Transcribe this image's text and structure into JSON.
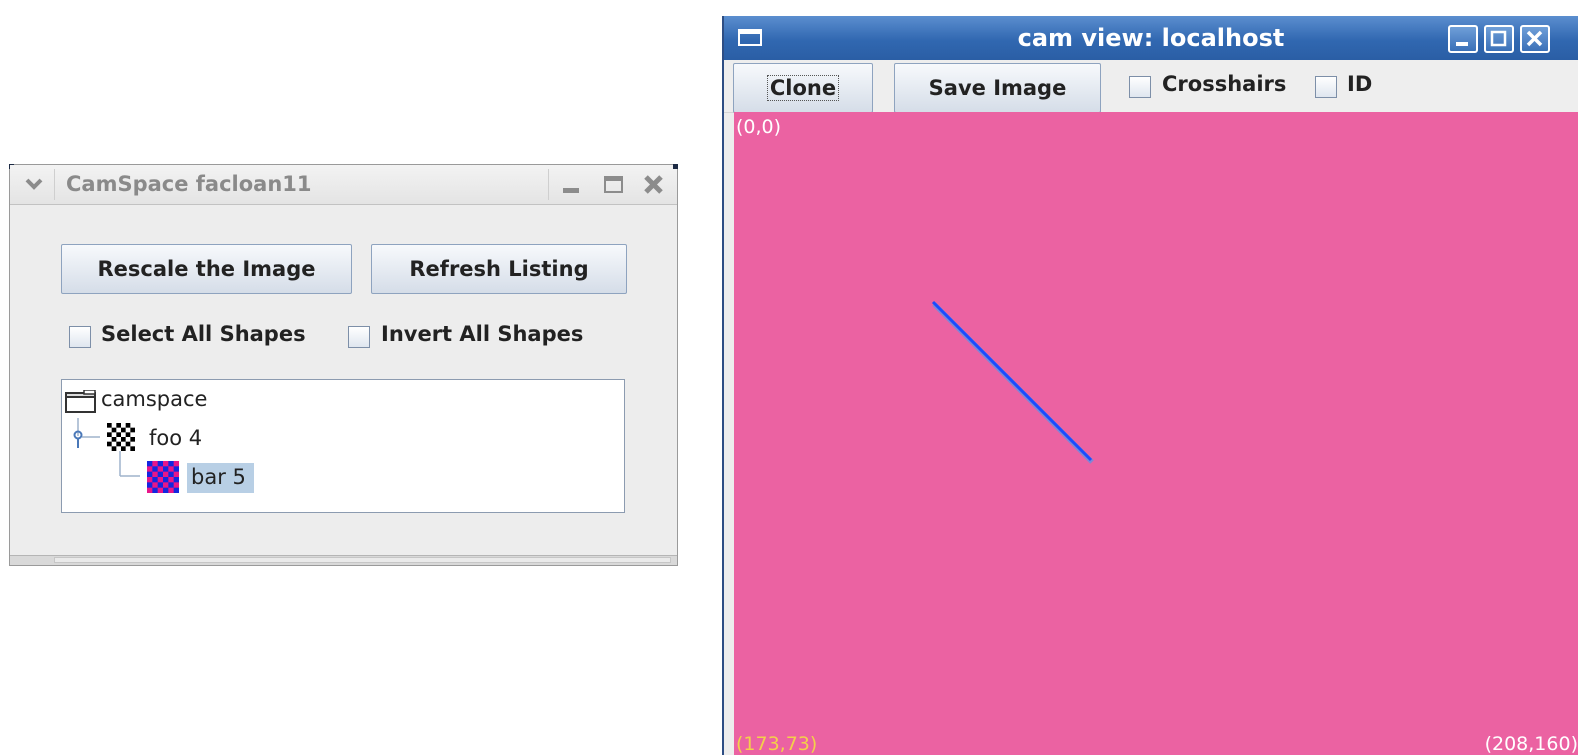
{
  "camspace_window": {
    "title": "CamSpace facloan11",
    "rescale_button": "Rescale the Image",
    "refresh_button": "Refresh Listing",
    "select_all_label": "Select All Shapes",
    "invert_all_label": "Invert All Shapes",
    "tree": {
      "root_label": "camspace",
      "foo_label": "foo 4",
      "bar_label": "bar 5"
    }
  },
  "camview_window": {
    "title": "cam view: localhost",
    "clone_button": "Clone",
    "save_button": "Save Image",
    "crosshairs_label": "Crosshairs",
    "id_label": "ID",
    "coord_top_left": "(0,0)",
    "coord_bottom_left": "(173,73)",
    "coord_bottom_right": "(208,160)"
  },
  "colors": {
    "camera_background": "#eb62a2",
    "line": "#1a4cff",
    "titlebar_active": "#3168b1",
    "selection": "#b8cfe5"
  },
  "icons": {
    "folder": "folder-icon",
    "checker_black": "checker-black-icon",
    "checker_red_blue": "checker-red-blue-icon"
  }
}
